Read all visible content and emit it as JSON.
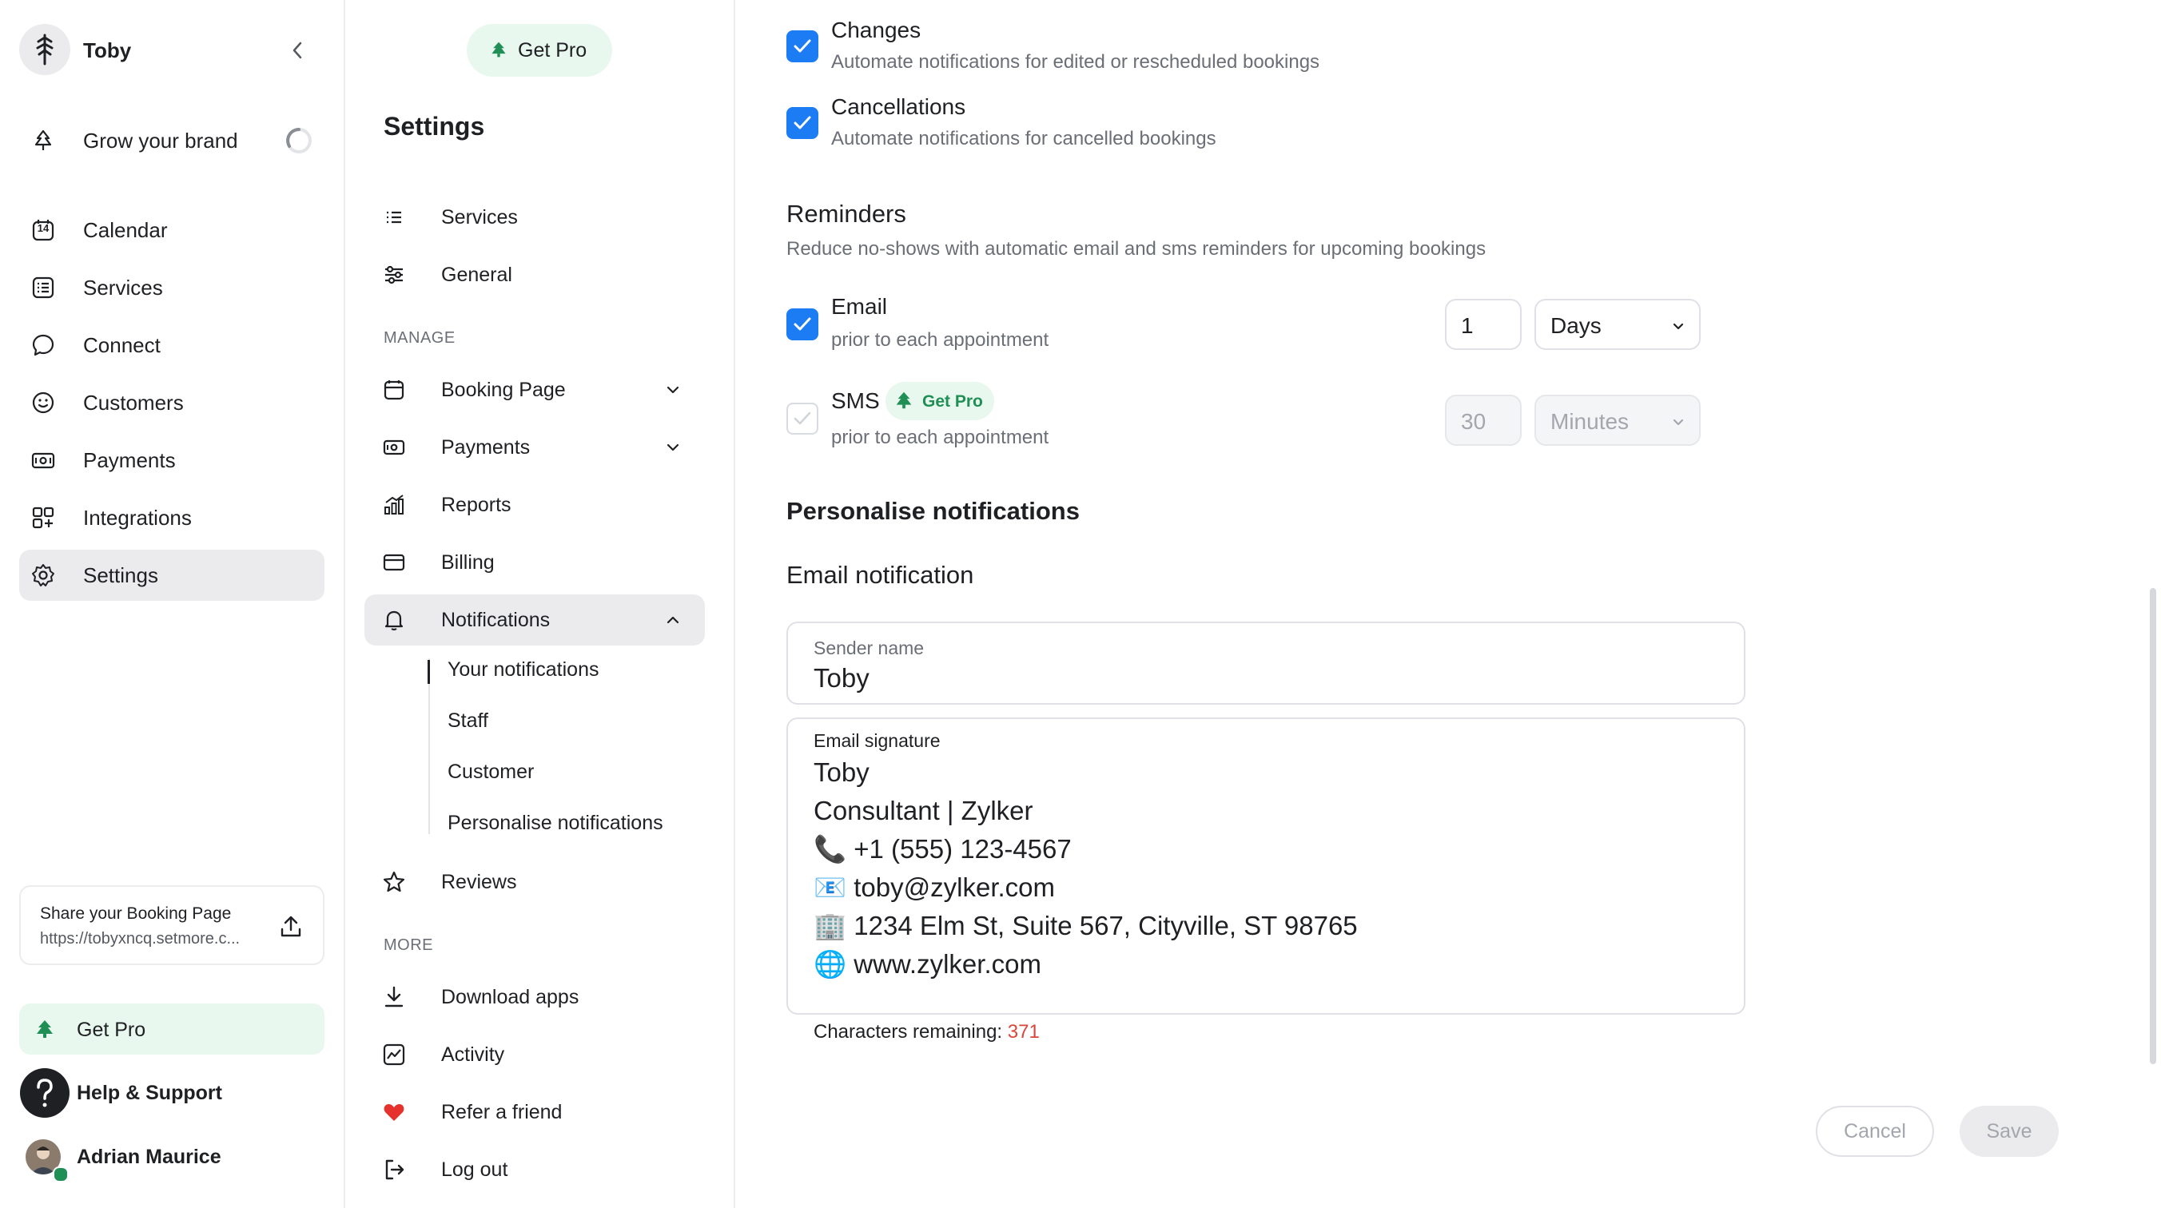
{
  "sidebar": {
    "user_name": "Toby",
    "grow_label": "Grow your brand",
    "nav": [
      {
        "label": "Calendar",
        "icon": "calendar-icon",
        "calendar_day": "14"
      },
      {
        "label": "Services",
        "icon": "list-icon"
      },
      {
        "label": "Connect",
        "icon": "chat-bubble-icon"
      },
      {
        "label": "Customers",
        "icon": "smiley-icon"
      },
      {
        "label": "Payments",
        "icon": "money-icon"
      },
      {
        "label": "Integrations",
        "icon": "grid-plus-icon"
      },
      {
        "label": "Settings",
        "icon": "gear-icon"
      }
    ],
    "share": {
      "title": "Share your Booking Page",
      "url": "https://tobyxncq.setmore.c..."
    },
    "get_pro": "Get Pro",
    "help": "Help & Support",
    "account_name": "Adrian Maurice"
  },
  "settings_nav": {
    "get_pro": "Get Pro",
    "title": "Settings",
    "top_items": [
      {
        "label": "Services",
        "icon": "list-icon"
      },
      {
        "label": "General",
        "icon": "sliders-icon"
      }
    ],
    "manage_head": "MANAGE",
    "manage_items": [
      {
        "label": "Booking Page",
        "icon": "booking-page-icon"
      },
      {
        "label": "Payments",
        "icon": "money-icon"
      },
      {
        "label": "Reports",
        "icon": "reports-icon"
      },
      {
        "label": "Billing",
        "icon": "card-icon"
      },
      {
        "label": "Notifications",
        "icon": "bell-icon"
      }
    ],
    "notification_sub": [
      "Your notifications",
      "Staff",
      "Customer",
      "Personalise notifications"
    ],
    "reviews": "Reviews",
    "more_head": "MORE",
    "more_items": [
      {
        "label": "Download apps",
        "icon": "download-icon"
      },
      {
        "label": "Activity",
        "icon": "activity-icon"
      },
      {
        "label": "Refer a friend",
        "icon": "heart-icon"
      },
      {
        "label": "Log out",
        "icon": "logout-icon"
      }
    ]
  },
  "main": {
    "changes": {
      "title": "Changes",
      "desc": "Automate notifications for edited or rescheduled bookings",
      "checked": true
    },
    "cancellations": {
      "title": "Cancellations",
      "desc": "Automate notifications for cancelled bookings",
      "checked": true
    },
    "reminders": {
      "heading": "Reminders",
      "desc": "Reduce no-shows with automatic email and sms reminders for upcoming bookings",
      "email": {
        "title": "Email",
        "desc": "prior to each appointment",
        "value": "1",
        "unit": "Days",
        "checked": true
      },
      "sms": {
        "title": "SMS",
        "badge": "Get Pro",
        "desc": "prior to each appointment",
        "value": "30",
        "unit": "Minutes",
        "checked": true,
        "disabled": true
      }
    },
    "personalise_heading": "Personalise notifications",
    "email_notification_heading": "Email notification",
    "sender": {
      "label": "Sender name",
      "value": "Toby"
    },
    "signature": {
      "label": "Email signature",
      "lines": [
        "Toby",
        "Consultant | Zylker",
        "📞 +1 (555) 123-4567",
        "📧 toby@zylker.com",
        "🏢 1234 Elm St, Suite 567, Cityville, ST 98765",
        "🌐 www.zylker.com"
      ]
    },
    "chars_label": "Characters remaining:",
    "chars_value": "371",
    "cancel": "Cancel",
    "save": "Save"
  },
  "colors": {
    "accent": "#1b7cf3",
    "pro_green": "#1f8f55",
    "pro_bg": "#e9f8ef",
    "counter": "#d9463a"
  }
}
